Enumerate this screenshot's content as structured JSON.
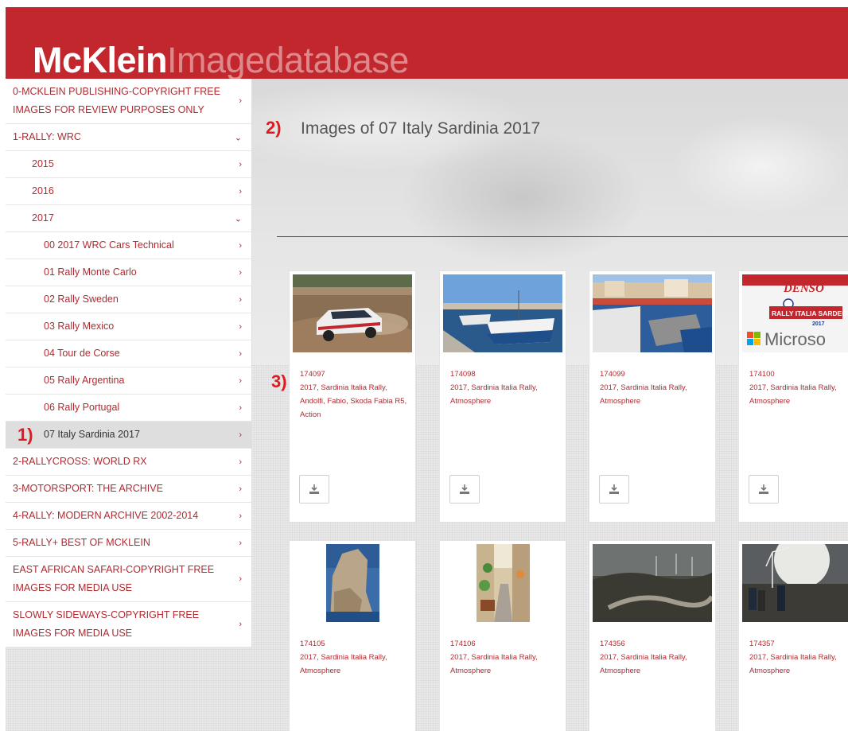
{
  "header": {
    "logo_bold": "McKlein",
    "logo_light": "Imagedatabase"
  },
  "sidebar": {
    "items": [
      {
        "label": "0-MCKLEIN PUBLISHING-COPYRIGHT FREE IMAGES FOR REVIEW PURPOSES ONLY",
        "chevron": "›"
      },
      {
        "label": "1-RALLY: WRC",
        "chevron": "⌄"
      },
      {
        "label": "2015",
        "chevron": "›"
      },
      {
        "label": "2016",
        "chevron": "›"
      },
      {
        "label": "2017",
        "chevron": "⌄"
      },
      {
        "label": "00 2017 WRC Cars Technical",
        "chevron": "›"
      },
      {
        "label": "01 Rally Monte Carlo",
        "chevron": "›"
      },
      {
        "label": "02 Rally Sweden",
        "chevron": "›"
      },
      {
        "label": "03 Rally Mexico",
        "chevron": "›"
      },
      {
        "label": "04 Tour de Corse",
        "chevron": "›"
      },
      {
        "label": "05 Rally Argentina",
        "chevron": "›"
      },
      {
        "label": "06 Rally Portugal",
        "chevron": "›"
      },
      {
        "label": "07 Italy Sardinia 2017",
        "chevron": "›"
      },
      {
        "label": "2-RALLYCROSS: WORLD RX",
        "chevron": "›"
      },
      {
        "label": "3-MOTORSPORT: THE ARCHIVE",
        "chevron": "›"
      },
      {
        "label": "4-RALLY: MODERN ARCHIVE 2002-2014",
        "chevron": "›"
      },
      {
        "label": "5-RALLY+ BEST OF MCKLEIN",
        "chevron": "›"
      },
      {
        "label": "EAST AFRICAN SAFARI-COPYRIGHT FREE IMAGES FOR MEDIA USE",
        "chevron": "›"
      },
      {
        "label": "SLOWLY SIDEWAYS-COPYRIGHT FREE IMAGES FOR MEDIA USE",
        "chevron": "›"
      }
    ]
  },
  "markers": {
    "one": "1)",
    "two": "2)",
    "three": "3)"
  },
  "main": {
    "title": "Images of 07 Italy Sardinia 2017",
    "cards": [
      {
        "id": "174097",
        "desc": "2017, Sardinia Italia Rally, Andolfi, Fabio, Skoda Fabia R5, Action"
      },
      {
        "id": "174098",
        "desc": "2017, Sardinia Italia Rally, Atmosphere"
      },
      {
        "id": "174099",
        "desc": "2017, Sardinia Italia Rally, Atmosphere"
      },
      {
        "id": "174100",
        "desc": "2017, Sardinia Italia Rally, Atmosphere"
      },
      {
        "id": "174105",
        "desc": "2017, Sardinia Italia Rally, Atmosphere"
      },
      {
        "id": "174106",
        "desc": "2017, Sardinia Italia Rally, Atmosphere"
      },
      {
        "id": "174356",
        "desc": "2017, Sardinia Italia Rally, Atmosphere"
      },
      {
        "id": "174357",
        "desc": "2017, Sardinia Italia Rally, Atmosphere"
      }
    ],
    "photo_text": {
      "denso": "DENSO",
      "rally_banner": "RALLY ITALIA SARDEGNA",
      "year": "2017",
      "sponsor": "Microso"
    }
  },
  "colors": {
    "brand_red": "#c1272d",
    "link_red": "#b02a30",
    "marker_red": "#e0191f"
  },
  "icons": {
    "download": "download-icon",
    "chevron_right": "chevron-right-icon",
    "chevron_down": "chevron-down-icon"
  }
}
